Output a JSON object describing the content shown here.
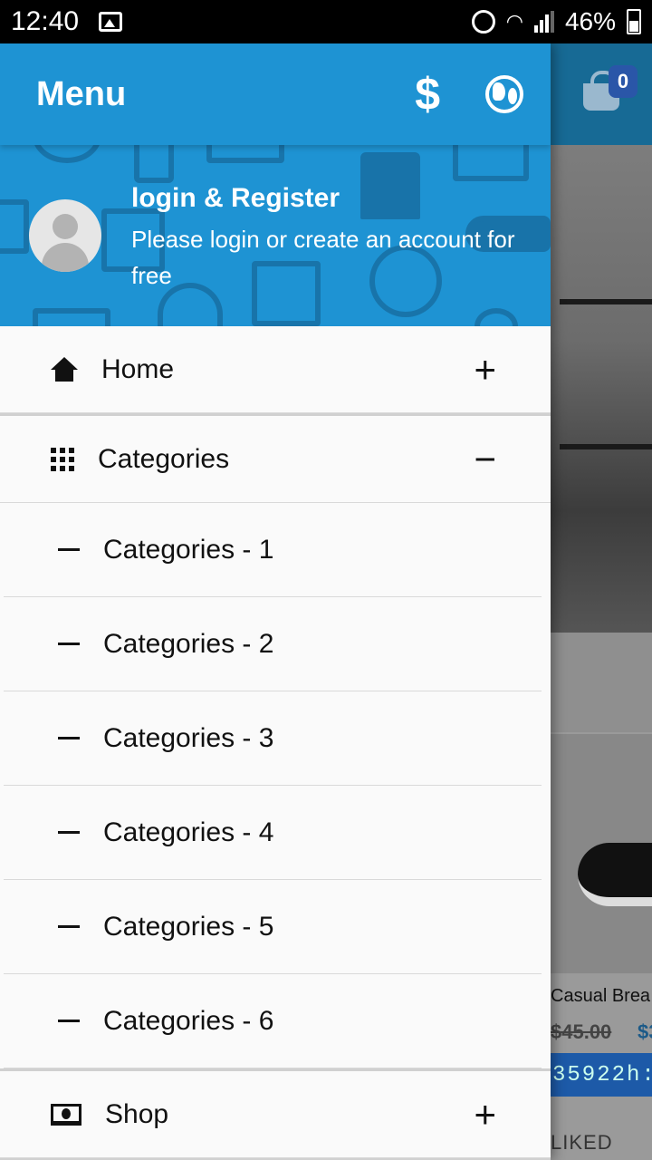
{
  "status_bar": {
    "time": "12:40",
    "battery_percent": "46%",
    "signal_level": 3
  },
  "drawer": {
    "title": "Menu",
    "icons": [
      "dollar-icon",
      "globe-icon"
    ],
    "header": {
      "login_title": "login & Register",
      "login_subtitle": "Please login or create an account for free"
    },
    "items": {
      "home": {
        "label": "Home",
        "toggle": "+"
      },
      "categories": {
        "label": "Categories",
        "toggle": "−"
      },
      "shop": {
        "label": "Shop",
        "toggle": "+"
      }
    },
    "subcategories": [
      "Categories - 1",
      "Categories - 2",
      "Categories - 3",
      "Categories - 4",
      "Categories - 5",
      "Categories - 6"
    ]
  },
  "background_app": {
    "cart_count": "0",
    "product_title": "Casual Brea",
    "old_price": "$45.00",
    "new_price": "$3",
    "timer": "35922h:",
    "liked_label": "LIKED"
  },
  "colors": {
    "primary": "#1e93d3",
    "primary_dark": "#17699c",
    "drawer_bg": "#fafafa"
  }
}
